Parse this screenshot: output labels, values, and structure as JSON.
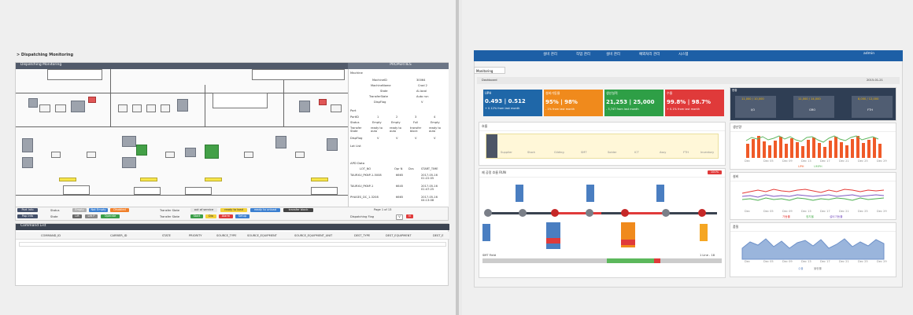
{
  "left": {
    "page_title": "> Dispatching Monitoring",
    "panel_title": "Dispatching Monitoring",
    "properties_title": "PROPERTIES",
    "machine_section": "Machine",
    "machine_rows": [
      {
        "k": "MachineID",
        "v": "30064"
      },
      {
        "k": "MachineName",
        "v": "Crad 2"
      },
      {
        "k": "State",
        "v": "Al-local"
      },
      {
        "k": "TransferState",
        "v": "Auto run"
      },
      {
        "k": "DispFlag",
        "v": "V"
      }
    ],
    "port_section": "Port",
    "port_headers": [
      "PortID",
      "1",
      "2",
      "3",
      "4"
    ],
    "port_rows": [
      [
        "Status",
        "Empty",
        "Empty",
        "Full",
        "Empty"
      ],
      [
        "Transfer State",
        "ready to auto",
        "ready to auto",
        "transfer block",
        "ready to auto"
      ],
      [
        "DispFlag",
        "V",
        "V",
        "V",
        "V"
      ]
    ],
    "lot_section": "Lot List",
    "apd_section": "APD Data",
    "apd_headers": [
      "LOT_NO",
      "Opr N",
      "Dcs",
      "START_TIME"
    ],
    "apd_rows": [
      [
        "TAURXU_PKNP-1-5008",
        "6665",
        "",
        "2017-05-16 01:22:05"
      ],
      [
        "TAURXU_PKNP-1",
        "6645",
        "",
        "2017-05-16 01:47:25"
      ],
      [
        "PHASES_DC_1-3208",
        "6665",
        "",
        "2017-05-16 04:13:08"
      ]
    ],
    "legend": {
      "port_info": "Port Info",
      "pop_info": "Pop Info",
      "status_label": "Status",
      "state_label": "State",
      "statuses": [
        "Empty",
        "Not Empty",
        "Disabled"
      ],
      "states": [
        "Lift",
        "Lift P",
        "Operate"
      ],
      "transfer_state_label": "Transfer State",
      "transfer_states_1": [
        "out of service",
        "ready to load",
        "ready to unload",
        "transfer block"
      ],
      "transfer_states_2": [
        "Start",
        "Dia",
        "Alarm",
        "Setup"
      ],
      "pager": "Page 1 of 13",
      "dispatching_flag": "Dispatching Flag",
      "flag_values": [
        "V",
        "N"
      ]
    },
    "command_list_title": "Command List",
    "command_headers": [
      "COMMAND_ID",
      "CARRIER_ID",
      "STATE",
      "PRIORITY",
      "SOURCE_TYPE",
      "SOURCE_EQUIPMENT",
      "SOURCE_EQUIPMENT_UNIT",
      "DEST_TYPE",
      "DEST_EQUIPMENT",
      "DEST_E"
    ]
  },
  "right": {
    "nav": [
      "설비 관리",
      "작업 관리",
      "설비 관리",
      "예외처리 관리",
      "시스템"
    ],
    "user": "admin",
    "tab": "Monitoring",
    "dashboard": "Dashboard",
    "date": "2015-01-21",
    "cards": [
      {
        "title": "UPH",
        "value": "0.493 | 0.512",
        "foot": "+ 0.12%  from last month",
        "color": "#1f67a8"
      },
      {
        "title": "설비가동율",
        "value": "95% | 98%",
        "foot": "- 1%  from last month",
        "color": "#f08a1c"
      },
      {
        "title": "생산실적",
        "value": "21,253 | 25,000",
        "foot": "- 3,747  from last month",
        "color": "#2e9f46"
      },
      {
        "title": "수율",
        "value": "99.8% | 98.7%",
        "foot": "+ 0.1%  from last month",
        "color": "#e03a3a"
      }
    ],
    "status_panel": "현황",
    "status_items": [
      {
        "label": "11,000 / 10,000",
        "name": "I/O"
      },
      {
        "label": "11,000 / 14,000",
        "name": "GRO"
      },
      {
        "label": "8,000 / 12,000",
        "name": "FTH"
      }
    ],
    "flow_title": "흐름",
    "flow_labels": [
      "Supplier",
      "Stock",
      "Gilding",
      "SMT",
      "Solder",
      "ICT",
      "Assy",
      "FTH",
      "Inventory"
    ],
    "process_title": "제 공정 흐름 RUN",
    "process_badge": "100%",
    "process_nodes": [
      "1",
      "2",
      "3",
      "4",
      "5",
      "6",
      "7"
    ],
    "process_tags": [
      "대기",
      "완료",
      "이상"
    ],
    "process_footer_left": "SMT Field",
    "process_footer_right": "1 Line - 18",
    "chart1_title": "생산량",
    "chart1_labels": [
      "Dec",
      "Dec 05",
      "Dec 09",
      "Dec 13",
      "Dec 17",
      "Dec 21",
      "Dec 25",
      "Dec 29"
    ],
    "chart1_legend": [
      "UPH",
      "UMPH"
    ],
    "chart2_title": "설비",
    "chart2_labels": [
      "Dec",
      "Dec 05",
      "Dec 09",
      "Dec 13",
      "Dec 17",
      "Dec 21",
      "Dec 25",
      "Dec 29"
    ],
    "chart2_legend": [
      "가동률",
      "정지율",
      "설비가동률"
    ],
    "chart3_title": "품질",
    "chart3_labels": [
      "Dec",
      "Dec 05",
      "Dec 09",
      "Dec 13",
      "Dec 17",
      "Dec 21",
      "Dec 25",
      "Dec 29"
    ],
    "chart3_legend": [
      "수율",
      "불량률"
    ]
  }
}
